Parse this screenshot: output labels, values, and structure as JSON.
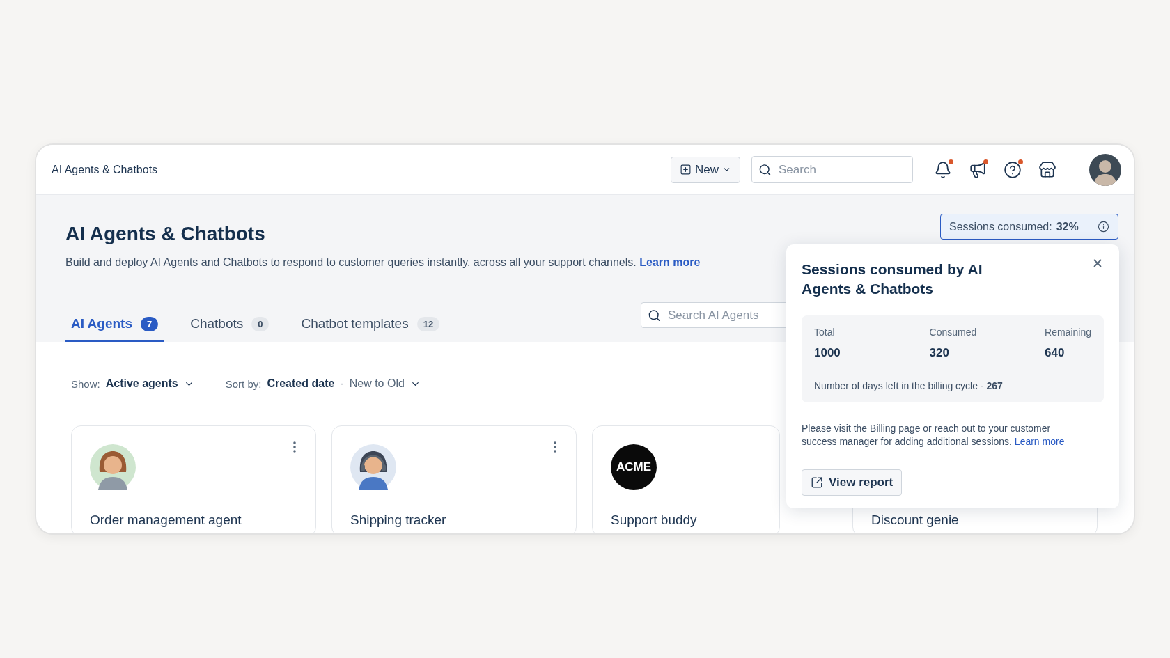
{
  "header": {
    "title": "AI Agents & Chatbots",
    "new_button": "New",
    "search": {
      "placeholder": "Search"
    },
    "icons": [
      {
        "kind": "bell",
        "badge": true
      },
      {
        "kind": "megaphone",
        "badge": true
      },
      {
        "kind": "help",
        "badge": true
      },
      {
        "kind": "store",
        "badge": false
      }
    ]
  },
  "page": {
    "title": "AI Agents & Chatbots",
    "description": "Build and deploy AI Agents and Chatbots to respond to customer queries instantly, across all your support channels.",
    "learn_more": "Learn more"
  },
  "sessions_button": {
    "label": "Sessions consumed:",
    "value": "32%"
  },
  "tabs": [
    {
      "label": "AI Agents",
      "count": "7",
      "selected": true
    },
    {
      "label": "Chatbots",
      "count": "0",
      "selected": false
    },
    {
      "label": "Chatbot templates",
      "count": "12",
      "selected": false
    }
  ],
  "agent_search": {
    "placeholder": "Search AI Agents"
  },
  "filters": {
    "show_label": "Show:",
    "show_value": "Active agents",
    "sort_label": "Sort by:",
    "sort_value": "Created date",
    "sort_separator": "-",
    "sort_order": "New to Old"
  },
  "cards": [
    {
      "name": "Order management agent",
      "avatar": {
        "kind": "figure"
      },
      "menu": true
    },
    {
      "name": "Shipping tracker",
      "avatar": {
        "kind": "headset"
      },
      "menu": true
    },
    {
      "name": "Support buddy",
      "avatar": {
        "kind": "logo",
        "text": "ACME"
      },
      "menu": false
    },
    {
      "name": "Discount genie",
      "menu": false
    }
  ],
  "popover": {
    "title": "Sessions consumed by AI Agents & Chatbots",
    "stats": [
      {
        "label": "Total",
        "value": "1000"
      },
      {
        "label": "Consumed",
        "value": "320"
      },
      {
        "label": "Remaining",
        "value": "640"
      }
    ],
    "days_label": "Number of days left in the billing cycle -",
    "days_value": "267",
    "note": "Please visit the Billing page or reach out to your customer success manager for adding additional sessions.",
    "note_link": "Learn more",
    "button": "View report"
  }
}
